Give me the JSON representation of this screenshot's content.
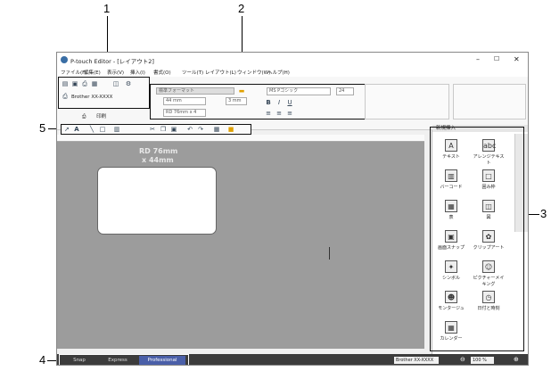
{
  "app": {
    "title": "P-touch Editor - [レイアウト2]"
  },
  "menu": {
    "items": [
      "ファイル(F)",
      "編集(E)",
      "表示(V)",
      "挿入(I)",
      "書式(O)",
      "ツール(T)",
      "レイアウト(L)",
      "ウィンドウ(W)",
      "ヘルプ(H)"
    ]
  },
  "printer": {
    "name": "Brother XX-XXXX",
    "print_label": "印刷"
  },
  "ribbon": {
    "format": "標準フォーマット",
    "length": "44 mm",
    "margin": "3 mm",
    "media": "RD 76mm x 4",
    "font": "MS Pゴシック",
    "size": "24"
  },
  "canvas": {
    "label_line1": "RD 76mm",
    "label_line2": "x 44mm"
  },
  "side": {
    "header": "新規挿入",
    "items": [
      "テキスト",
      "アレンジテキスト",
      "バーコード",
      "囲み枠",
      "表",
      "図",
      "画面スナップ",
      "クリップアート",
      "シンボル",
      "ピクチャーメイキング",
      "モンタージュ",
      "日付と時刻",
      "カレンダー"
    ]
  },
  "status": {
    "modes": [
      "Snap",
      "Express",
      "Professional"
    ],
    "printer": "Brother XX-XXXX",
    "zoom": "100 %"
  },
  "callouts": [
    "1",
    "2",
    "3",
    "4",
    "5"
  ]
}
